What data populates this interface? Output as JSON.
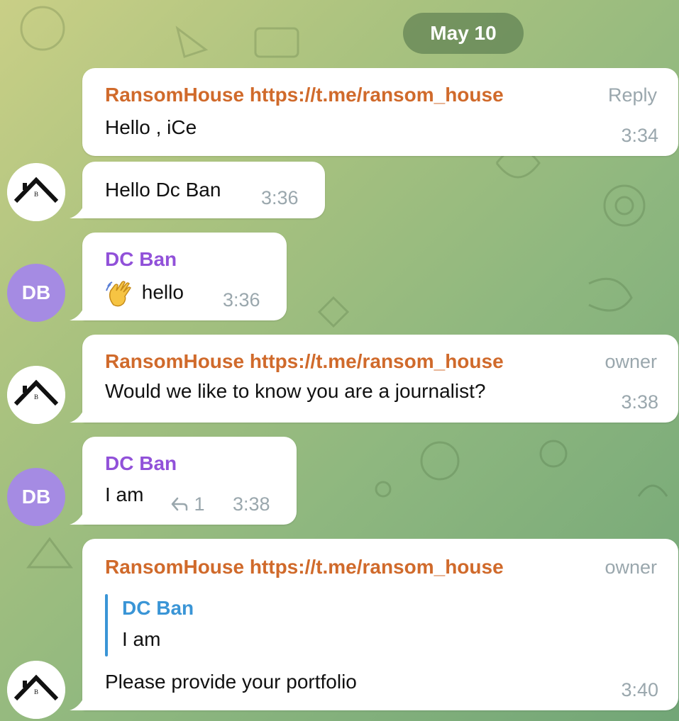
{
  "date_label": "May 10",
  "messages": [
    {
      "sender": "RansomHouse https://t.me/ransom_house",
      "tag": "Reply",
      "text": "Hello , iCe",
      "time": "3:34"
    },
    {
      "text": "Hello Dc Ban",
      "time": "3:36"
    },
    {
      "sender": "DC Ban",
      "text": "hello",
      "time": "3:36",
      "avatar_initials": "DB"
    },
    {
      "sender": "RansomHouse https://t.me/ransom_house",
      "tag": "owner",
      "text": "Would we like to know you are a journalist?",
      "time": "3:38"
    },
    {
      "sender": "DC Ban",
      "text": "I am",
      "replies": "1",
      "time": "3:38",
      "avatar_initials": "DB"
    },
    {
      "sender": "RansomHouse https://t.me/ransom_house",
      "tag": "owner",
      "quote_sender": "DC Ban",
      "quote_text": "I am",
      "text": "Please provide  your portfolio",
      "time": "3:40"
    }
  ],
  "colors": {
    "ransom_name": "#d06a2b",
    "dc_name": "#9151d9",
    "quote_accent": "#3a95d6",
    "avatar_db": "#a58be3"
  },
  "icons": [
    "ransomhouse-logo-icon",
    "waving-hand-icon",
    "reply-arrow-icon"
  ]
}
